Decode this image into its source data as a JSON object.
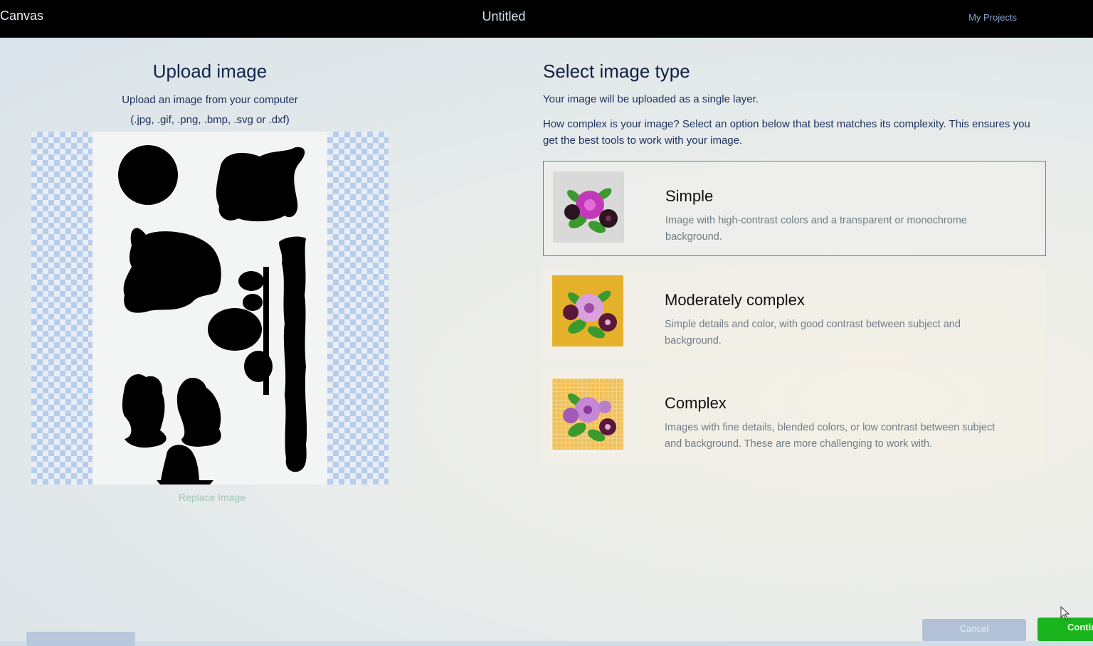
{
  "header": {
    "brand": "Canvas",
    "document_title": "Untitled",
    "projects_link": "My Projects"
  },
  "upload": {
    "heading": "Upload image",
    "subtitle": "Upload an image from your computer",
    "formats": "(.jpg, .gif, .png, .bmp, .svg or .dxf)",
    "replace_link": "Replace Image"
  },
  "image_type": {
    "heading": "Select image type",
    "note": "Your image will be uploaded as a single layer.",
    "instructions": "How complex is your image? Select an option below that best matches its complexity. This ensures you get the best tools to work with your image.",
    "options": [
      {
        "title": "Simple",
        "description": "Image with high-contrast colors and a transparent or monochrome background.",
        "selected": true,
        "thumb_bg": "#d9d9d9"
      },
      {
        "title": "Moderately complex",
        "description": "Simple details and color, with good contrast between subject and background.",
        "selected": false,
        "thumb_bg": "#e5b12a"
      },
      {
        "title": "Complex",
        "description": "Images with fine details, blended colors, or low contrast between subject and background. These are more challenging to work with.",
        "selected": false,
        "thumb_bg": "#f0c05a"
      }
    ]
  },
  "footer": {
    "cancel": "Cancel",
    "continue": "Continue"
  },
  "colors": {
    "accent_green": "#19b41e",
    "selected_border": "#4c9e4c",
    "header_bg": "#000000"
  }
}
